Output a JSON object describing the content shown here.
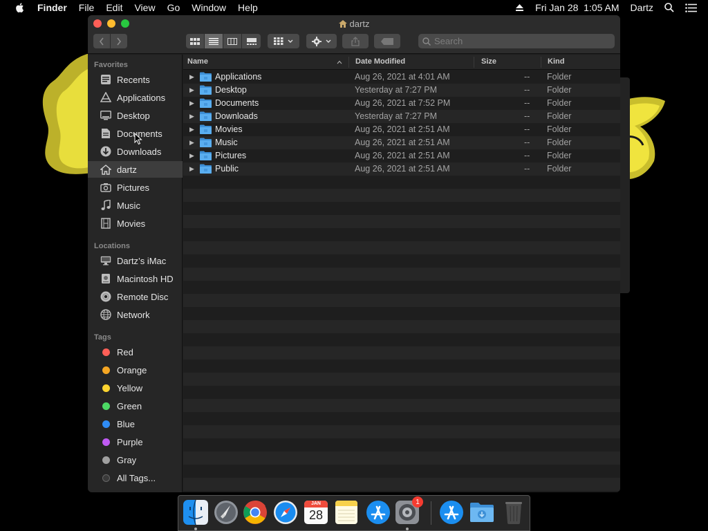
{
  "menubar": {
    "apple_icon": "apple-logo-icon",
    "app_name": "Finder",
    "items": [
      "File",
      "Edit",
      "View",
      "Go",
      "Window",
      "Help"
    ],
    "datetime": "Fri Jan 28  1:05 AM",
    "user": "Dartz"
  },
  "window": {
    "title": "dartz",
    "search_placeholder": "Search",
    "active_view": "list"
  },
  "sidebar": {
    "favorites_header": "Favorites",
    "favorites": [
      {
        "label": "Recents",
        "icon": "clock-icon"
      },
      {
        "label": "Applications",
        "icon": "applications-icon"
      },
      {
        "label": "Desktop",
        "icon": "desktop-icon"
      },
      {
        "label": "Documents",
        "icon": "document-icon"
      },
      {
        "label": "Downloads",
        "icon": "download-icon"
      },
      {
        "label": "dartz",
        "icon": "home-icon",
        "selected": true
      },
      {
        "label": "Pictures",
        "icon": "camera-icon"
      },
      {
        "label": "Music",
        "icon": "music-note-icon"
      },
      {
        "label": "Movies",
        "icon": "film-icon"
      }
    ],
    "locations_header": "Locations",
    "locations": [
      {
        "label": "Dartz’s iMac",
        "icon": "imac-icon"
      },
      {
        "label": "Macintosh HD",
        "icon": "hard-drive-icon"
      },
      {
        "label": "Remote Disc",
        "icon": "disc-icon"
      },
      {
        "label": "Network",
        "icon": "globe-icon"
      }
    ],
    "tags_header": "Tags",
    "tags": [
      {
        "label": "Red",
        "color": "#fe5f57"
      },
      {
        "label": "Orange",
        "color": "#f5a623"
      },
      {
        "label": "Yellow",
        "color": "#fed430"
      },
      {
        "label": "Green",
        "color": "#4cd964"
      },
      {
        "label": "Blue",
        "color": "#2f8cf5"
      },
      {
        "label": "Purple",
        "color": "#bf5af2"
      },
      {
        "label": "Gray",
        "color": "#a0a0a0"
      },
      {
        "label": "All Tags...",
        "color": "#3a3a3a"
      }
    ]
  },
  "columns": {
    "name": "Name",
    "date": "Date Modified",
    "size": "Size",
    "kind": "Kind"
  },
  "files": [
    {
      "name": "Applications",
      "date": "Aug 26, 2021 at 4:01 AM",
      "size": "--",
      "kind": "Folder"
    },
    {
      "name": "Desktop",
      "date": "Yesterday at 7:27 PM",
      "size": "--",
      "kind": "Folder"
    },
    {
      "name": "Documents",
      "date": "Aug 26, 2021 at 7:52 PM",
      "size": "--",
      "kind": "Folder"
    },
    {
      "name": "Downloads",
      "date": "Yesterday at 7:27 PM",
      "size": "--",
      "kind": "Folder"
    },
    {
      "name": "Movies",
      "date": "Aug 26, 2021 at 2:51 AM",
      "size": "--",
      "kind": "Folder"
    },
    {
      "name": "Music",
      "date": "Aug 26, 2021 at 2:51 AM",
      "size": "--",
      "kind": "Folder"
    },
    {
      "name": "Pictures",
      "date": "Aug 26, 2021 at 2:51 AM",
      "size": "--",
      "kind": "Folder"
    },
    {
      "name": "Public",
      "date": "Aug 26, 2021 at 2:51 AM",
      "size": "--",
      "kind": "Folder"
    }
  ],
  "dock": {
    "apps": [
      {
        "name": "Finder",
        "icon": "finder-icon",
        "running": true
      },
      {
        "name": "Launchpad",
        "icon": "launchpad-rocket-icon"
      },
      {
        "name": "Chrome",
        "icon": "chrome-icon"
      },
      {
        "name": "Safari",
        "icon": "safari-compass-icon"
      },
      {
        "name": "Calendar",
        "icon": "calendar-icon",
        "month": "JAN",
        "day": "28"
      },
      {
        "name": "Notes",
        "icon": "notes-icon"
      },
      {
        "name": "App Store",
        "icon": "app-store-icon"
      },
      {
        "name": "System Preferences",
        "icon": "gear-icon",
        "badge": "1",
        "running": true
      },
      {
        "name": "App Store",
        "icon": "app-store-icon"
      },
      {
        "name": "Downloads",
        "icon": "downloads-folder-icon"
      },
      {
        "name": "Trash",
        "icon": "trash-icon"
      }
    ]
  }
}
